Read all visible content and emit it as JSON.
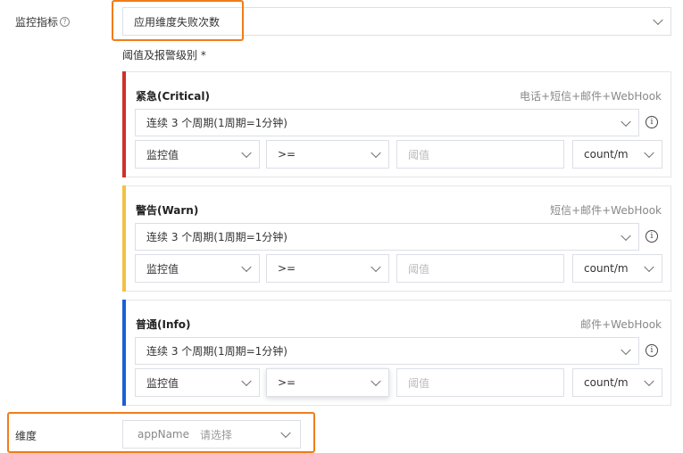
{
  "metric": {
    "label": "监控指标",
    "help_icon": "question-circle-icon",
    "value": "应用维度失败次数"
  },
  "threshold_section_label": "阈值及报警级别 *",
  "levels": [
    {
      "title": "紧急(Critical)",
      "notify": "电话+短信+邮件+WebHook",
      "color": "#d0302b",
      "period": "连续 3 个周期(1周期=1分钟)",
      "field": "监控值",
      "operator": ">=",
      "threshold_placeholder": "阈值",
      "unit": "count/m"
    },
    {
      "title": "警告(Warn)",
      "notify": "短信+邮件+WebHook",
      "color": "#f5c042",
      "period": "连续 3 个周期(1周期=1分钟)",
      "field": "监控值",
      "operator": ">=",
      "threshold_placeholder": "阈值",
      "unit": "count/m"
    },
    {
      "title": "普通(Info)",
      "notify": "邮件+WebHook",
      "color": "#1a5fd6",
      "period": "连续 3 个周期(1周期=1分钟)",
      "field": "监控值",
      "operator": ">=",
      "threshold_placeholder": "阈值",
      "unit": "count/m"
    }
  ],
  "dimension": {
    "label": "维度",
    "key": "appName",
    "placeholder": "请选择"
  },
  "colors": {
    "highlight": "#f07c1a"
  }
}
